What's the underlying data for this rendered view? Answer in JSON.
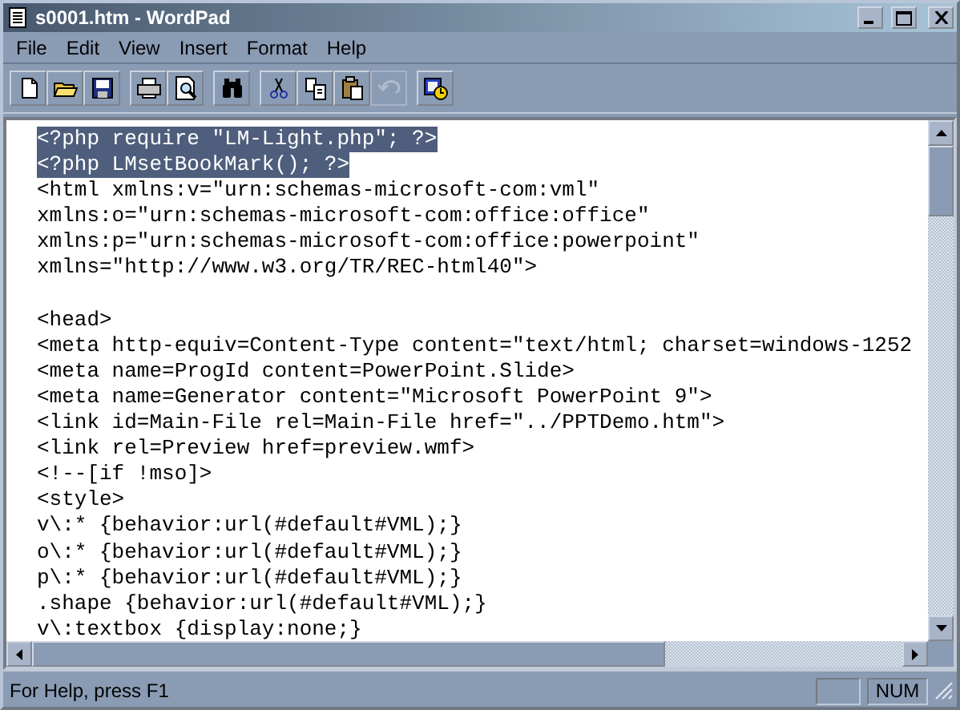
{
  "window": {
    "title": "s0001.htm - WordPad"
  },
  "menu": [
    "File",
    "Edit",
    "View",
    "Insert",
    "Format",
    "Help"
  ],
  "toolbar": [
    [
      {
        "kind": "new",
        "disabled": false
      },
      {
        "kind": "open",
        "disabled": false
      },
      {
        "kind": "save",
        "disabled": false
      }
    ],
    [
      {
        "kind": "print",
        "disabled": false
      },
      {
        "kind": "preview",
        "disabled": false
      }
    ],
    [
      {
        "kind": "find",
        "disabled": false
      }
    ],
    [
      {
        "kind": "cut",
        "disabled": false
      },
      {
        "kind": "copy",
        "disabled": false
      },
      {
        "kind": "paste",
        "disabled": false
      },
      {
        "kind": "undo",
        "disabled": true
      }
    ],
    [
      {
        "kind": "datetime",
        "disabled": false
      }
    ]
  ],
  "editor": {
    "lines": [
      {
        "text": "<?php require \"LM-Light.php\"; ?>",
        "selected": true
      },
      {
        "text": "<?php LMsetBookMark(); ?>",
        "selected": true
      },
      {
        "text": "<html xmlns:v=\"urn:schemas-microsoft-com:vml\"",
        "selected": false
      },
      {
        "text": "xmlns:o=\"urn:schemas-microsoft-com:office:office\"",
        "selected": false
      },
      {
        "text": "xmlns:p=\"urn:schemas-microsoft-com:office:powerpoint\"",
        "selected": false
      },
      {
        "text": "xmlns=\"http://www.w3.org/TR/REC-html40\">",
        "selected": false
      },
      {
        "selected": false
      },
      {
        "text": "<head>",
        "selected": false
      },
      {
        "text": "<meta http-equiv=Content-Type content=\"text/html; charset=windows-1252",
        "selected": false
      },
      {
        "text": "<meta name=ProgId content=PowerPoint.Slide>",
        "selected": false
      },
      {
        "text": "<meta name=Generator content=\"Microsoft PowerPoint 9\">",
        "selected": false
      },
      {
        "text": "<link id=Main-File rel=Main-File href=\"../PPTDemo.htm\">",
        "selected": false
      },
      {
        "text": "<link rel=Preview href=preview.wmf>",
        "selected": false
      },
      {
        "text": "<!--[if !mso]>",
        "selected": false
      },
      {
        "text": "<style>",
        "selected": false
      },
      {
        "text": "v\\:* {behavior:url(#default#VML);}",
        "selected": false
      },
      {
        "text": "o\\:* {behavior:url(#default#VML);}",
        "selected": false
      },
      {
        "text": "p\\:* {behavior:url(#default#VML);}",
        "selected": false
      },
      {
        "text": ".shape {behavior:url(#default#VML);}",
        "selected": false
      },
      {
        "text": "v\\:textbox {display:none;}",
        "selected": false
      }
    ]
  },
  "status_bar": {
    "text": "For Help, press F1",
    "indicators": [
      "NUM"
    ]
  }
}
